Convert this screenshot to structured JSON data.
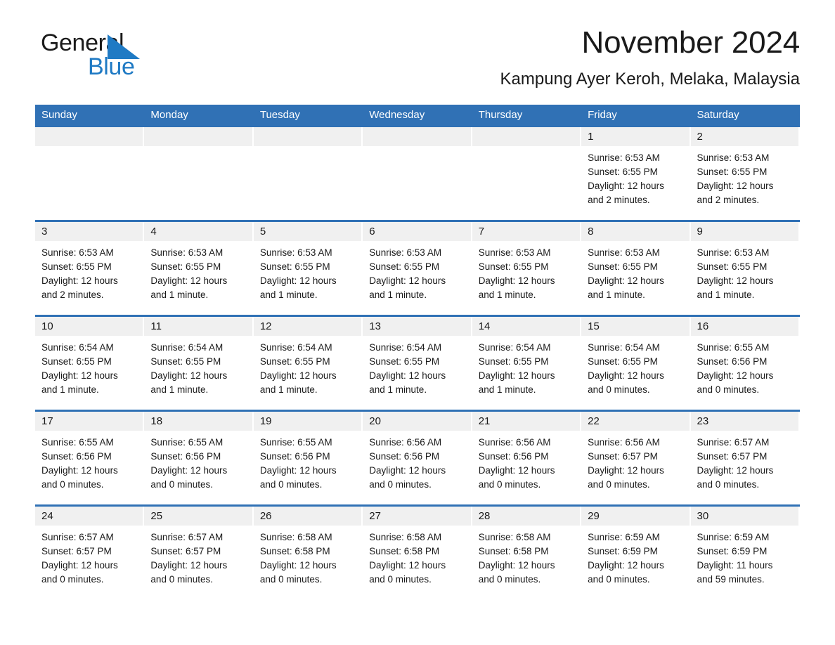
{
  "logo": {
    "word1": "General",
    "word2": "Blue",
    "triangle_color": "#1f7ac4",
    "text_color": "#1a1a1a"
  },
  "header": {
    "title": "November 2024",
    "subtitle": "Kampung Ayer Keroh, Melaka, Malaysia"
  },
  "colors": {
    "header_blue": "#3071b5",
    "day_band_gray": "#f0f0f0",
    "text": "#1a1a1a"
  },
  "weekdays": [
    "Sunday",
    "Monday",
    "Tuesday",
    "Wednesday",
    "Thursday",
    "Friday",
    "Saturday"
  ],
  "weeks": [
    [
      {
        "day": "",
        "sunrise": "",
        "sunset": "",
        "daylight1": "",
        "daylight2": ""
      },
      {
        "day": "",
        "sunrise": "",
        "sunset": "",
        "daylight1": "",
        "daylight2": ""
      },
      {
        "day": "",
        "sunrise": "",
        "sunset": "",
        "daylight1": "",
        "daylight2": ""
      },
      {
        "day": "",
        "sunrise": "",
        "sunset": "",
        "daylight1": "",
        "daylight2": ""
      },
      {
        "day": "",
        "sunrise": "",
        "sunset": "",
        "daylight1": "",
        "daylight2": ""
      },
      {
        "day": "1",
        "sunrise": "Sunrise: 6:53 AM",
        "sunset": "Sunset: 6:55 PM",
        "daylight1": "Daylight: 12 hours",
        "daylight2": "and 2 minutes."
      },
      {
        "day": "2",
        "sunrise": "Sunrise: 6:53 AM",
        "sunset": "Sunset: 6:55 PM",
        "daylight1": "Daylight: 12 hours",
        "daylight2": "and 2 minutes."
      }
    ],
    [
      {
        "day": "3",
        "sunrise": "Sunrise: 6:53 AM",
        "sunset": "Sunset: 6:55 PM",
        "daylight1": "Daylight: 12 hours",
        "daylight2": "and 2 minutes."
      },
      {
        "day": "4",
        "sunrise": "Sunrise: 6:53 AM",
        "sunset": "Sunset: 6:55 PM",
        "daylight1": "Daylight: 12 hours",
        "daylight2": "and 1 minute."
      },
      {
        "day": "5",
        "sunrise": "Sunrise: 6:53 AM",
        "sunset": "Sunset: 6:55 PM",
        "daylight1": "Daylight: 12 hours",
        "daylight2": "and 1 minute."
      },
      {
        "day": "6",
        "sunrise": "Sunrise: 6:53 AM",
        "sunset": "Sunset: 6:55 PM",
        "daylight1": "Daylight: 12 hours",
        "daylight2": "and 1 minute."
      },
      {
        "day": "7",
        "sunrise": "Sunrise: 6:53 AM",
        "sunset": "Sunset: 6:55 PM",
        "daylight1": "Daylight: 12 hours",
        "daylight2": "and 1 minute."
      },
      {
        "day": "8",
        "sunrise": "Sunrise: 6:53 AM",
        "sunset": "Sunset: 6:55 PM",
        "daylight1": "Daylight: 12 hours",
        "daylight2": "and 1 minute."
      },
      {
        "day": "9",
        "sunrise": "Sunrise: 6:53 AM",
        "sunset": "Sunset: 6:55 PM",
        "daylight1": "Daylight: 12 hours",
        "daylight2": "and 1 minute."
      }
    ],
    [
      {
        "day": "10",
        "sunrise": "Sunrise: 6:54 AM",
        "sunset": "Sunset: 6:55 PM",
        "daylight1": "Daylight: 12 hours",
        "daylight2": "and 1 minute."
      },
      {
        "day": "11",
        "sunrise": "Sunrise: 6:54 AM",
        "sunset": "Sunset: 6:55 PM",
        "daylight1": "Daylight: 12 hours",
        "daylight2": "and 1 minute."
      },
      {
        "day": "12",
        "sunrise": "Sunrise: 6:54 AM",
        "sunset": "Sunset: 6:55 PM",
        "daylight1": "Daylight: 12 hours",
        "daylight2": "and 1 minute."
      },
      {
        "day": "13",
        "sunrise": "Sunrise: 6:54 AM",
        "sunset": "Sunset: 6:55 PM",
        "daylight1": "Daylight: 12 hours",
        "daylight2": "and 1 minute."
      },
      {
        "day": "14",
        "sunrise": "Sunrise: 6:54 AM",
        "sunset": "Sunset: 6:55 PM",
        "daylight1": "Daylight: 12 hours",
        "daylight2": "and 1 minute."
      },
      {
        "day": "15",
        "sunrise": "Sunrise: 6:54 AM",
        "sunset": "Sunset: 6:55 PM",
        "daylight1": "Daylight: 12 hours",
        "daylight2": "and 0 minutes."
      },
      {
        "day": "16",
        "sunrise": "Sunrise: 6:55 AM",
        "sunset": "Sunset: 6:56 PM",
        "daylight1": "Daylight: 12 hours",
        "daylight2": "and 0 minutes."
      }
    ],
    [
      {
        "day": "17",
        "sunrise": "Sunrise: 6:55 AM",
        "sunset": "Sunset: 6:56 PM",
        "daylight1": "Daylight: 12 hours",
        "daylight2": "and 0 minutes."
      },
      {
        "day": "18",
        "sunrise": "Sunrise: 6:55 AM",
        "sunset": "Sunset: 6:56 PM",
        "daylight1": "Daylight: 12 hours",
        "daylight2": "and 0 minutes."
      },
      {
        "day": "19",
        "sunrise": "Sunrise: 6:55 AM",
        "sunset": "Sunset: 6:56 PM",
        "daylight1": "Daylight: 12 hours",
        "daylight2": "and 0 minutes."
      },
      {
        "day": "20",
        "sunrise": "Sunrise: 6:56 AM",
        "sunset": "Sunset: 6:56 PM",
        "daylight1": "Daylight: 12 hours",
        "daylight2": "and 0 minutes."
      },
      {
        "day": "21",
        "sunrise": "Sunrise: 6:56 AM",
        "sunset": "Sunset: 6:56 PM",
        "daylight1": "Daylight: 12 hours",
        "daylight2": "and 0 minutes."
      },
      {
        "day": "22",
        "sunrise": "Sunrise: 6:56 AM",
        "sunset": "Sunset: 6:57 PM",
        "daylight1": "Daylight: 12 hours",
        "daylight2": "and 0 minutes."
      },
      {
        "day": "23",
        "sunrise": "Sunrise: 6:57 AM",
        "sunset": "Sunset: 6:57 PM",
        "daylight1": "Daylight: 12 hours",
        "daylight2": "and 0 minutes."
      }
    ],
    [
      {
        "day": "24",
        "sunrise": "Sunrise: 6:57 AM",
        "sunset": "Sunset: 6:57 PM",
        "daylight1": "Daylight: 12 hours",
        "daylight2": "and 0 minutes."
      },
      {
        "day": "25",
        "sunrise": "Sunrise: 6:57 AM",
        "sunset": "Sunset: 6:57 PM",
        "daylight1": "Daylight: 12 hours",
        "daylight2": "and 0 minutes."
      },
      {
        "day": "26",
        "sunrise": "Sunrise: 6:58 AM",
        "sunset": "Sunset: 6:58 PM",
        "daylight1": "Daylight: 12 hours",
        "daylight2": "and 0 minutes."
      },
      {
        "day": "27",
        "sunrise": "Sunrise: 6:58 AM",
        "sunset": "Sunset: 6:58 PM",
        "daylight1": "Daylight: 12 hours",
        "daylight2": "and 0 minutes."
      },
      {
        "day": "28",
        "sunrise": "Sunrise: 6:58 AM",
        "sunset": "Sunset: 6:58 PM",
        "daylight1": "Daylight: 12 hours",
        "daylight2": "and 0 minutes."
      },
      {
        "day": "29",
        "sunrise": "Sunrise: 6:59 AM",
        "sunset": "Sunset: 6:59 PM",
        "daylight1": "Daylight: 12 hours",
        "daylight2": "and 0 minutes."
      },
      {
        "day": "30",
        "sunrise": "Sunrise: 6:59 AM",
        "sunset": "Sunset: 6:59 PM",
        "daylight1": "Daylight: 11 hours",
        "daylight2": "and 59 minutes."
      }
    ]
  ]
}
